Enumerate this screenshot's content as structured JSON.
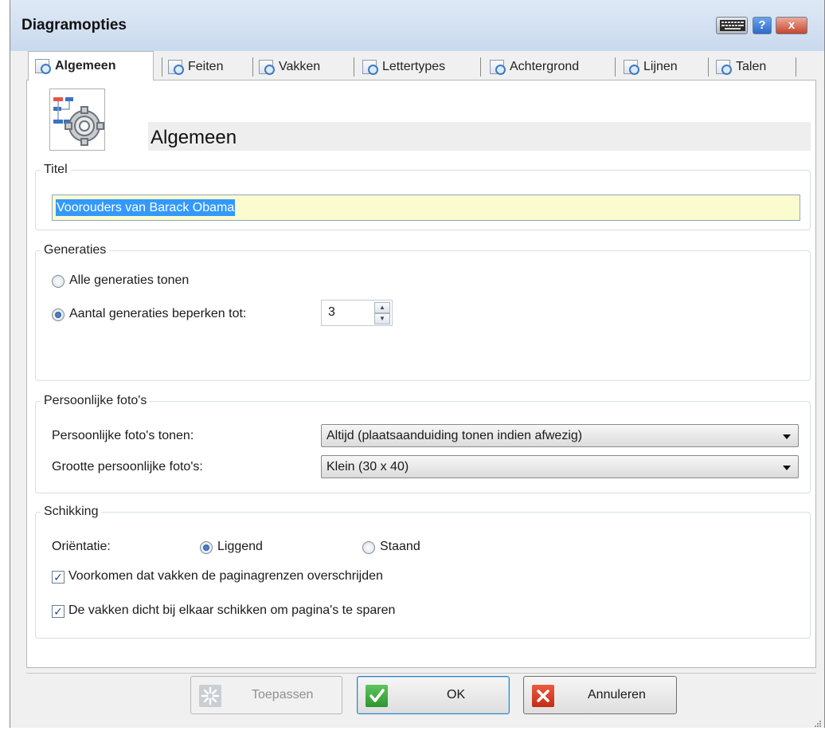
{
  "window": {
    "title": "Diagramopties",
    "help_label": "?",
    "close_label": "x"
  },
  "tabs": [
    {
      "label": "Algemeen",
      "icon": "general-settings-icon",
      "active": true
    },
    {
      "label": "Feiten",
      "icon": "facts-icon"
    },
    {
      "label": "Vakken",
      "icon": "boxes-icon"
    },
    {
      "label": "Lettertypes",
      "icon": "fonts-icon"
    },
    {
      "label": "Achtergrond",
      "icon": "background-icon"
    },
    {
      "label": "Lijnen",
      "icon": "lines-icon"
    },
    {
      "label": "Talen",
      "icon": "languages-icon"
    }
  ],
  "page": {
    "title": "Algemeen"
  },
  "titel_group": {
    "legend": "Titel",
    "value": "Voorouders van Barack Obama"
  },
  "generaties": {
    "legend": "Generaties",
    "option_all": "Alle generaties tonen",
    "option_limit": "Aantal generaties beperken tot:",
    "selected": "limit",
    "limit_value": "3"
  },
  "fotos": {
    "legend": "Persoonlijke foto's",
    "show_label": "Persoonlijke foto's tonen:",
    "show_value": "Altijd (plaatsaanduiding tonen indien afwezig)",
    "size_label": "Grootte persoonlijke foto's:",
    "size_value": "Klein (30 x 40)"
  },
  "schikking": {
    "legend": "Schikking",
    "orientation_label": "Oriëntatie:",
    "landscape": "Liggend",
    "portrait": "Staand",
    "orientation_selected": "Liggend",
    "check1": "Voorkomen dat vakken de paginagrenzen overschrijden",
    "check1_checked": true,
    "check2": "De vakken dicht bij elkaar schikken om pagina's te sparen",
    "check2_checked": true
  },
  "buttons": {
    "apply": "Toepassen",
    "ok": "OK",
    "cancel": "Annuleren"
  },
  "colors": {
    "title_field_bg": "#fbfbd0",
    "selection": "#3399ff",
    "ok_icon": "#3aa83a",
    "cancel_icon": "#d93a22"
  }
}
